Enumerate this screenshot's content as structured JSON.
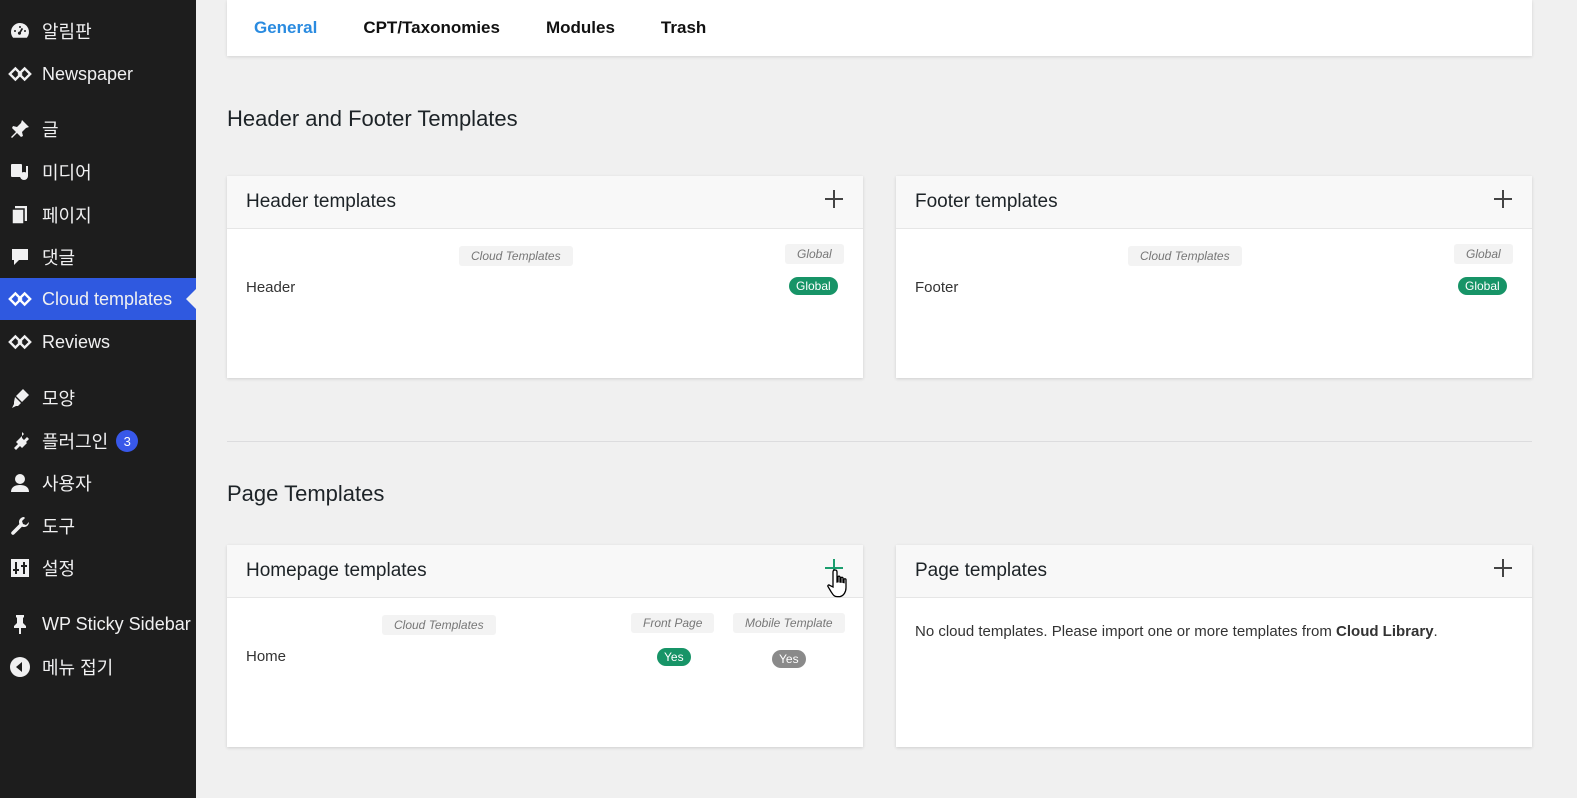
{
  "sidebar": {
    "items": [
      {
        "label": "알림판",
        "icon": "dashboard-icon"
      },
      {
        "label": "Newspaper",
        "icon": "newspaper-logo-icon"
      },
      {
        "label": "글",
        "icon": "pin-icon"
      },
      {
        "label": "미디어",
        "icon": "media-icon"
      },
      {
        "label": "페이지",
        "icon": "pages-icon"
      },
      {
        "label": "댓글",
        "icon": "comment-icon"
      },
      {
        "label": "Cloud templates",
        "icon": "newspaper-logo-icon"
      },
      {
        "label": "Reviews",
        "icon": "newspaper-logo-icon"
      },
      {
        "label": "모양",
        "icon": "brush-icon"
      },
      {
        "label": "플러그인",
        "icon": "plugin-icon",
        "badge": "3"
      },
      {
        "label": "사용자",
        "icon": "user-icon"
      },
      {
        "label": "도구",
        "icon": "wrench-icon"
      },
      {
        "label": "설정",
        "icon": "settings-icon"
      },
      {
        "label": "WP Sticky Sidebar",
        "icon": "pushpin-icon"
      },
      {
        "label": "메뉴 접기",
        "icon": "collapse-icon"
      }
    ],
    "active_index": 6,
    "active_color": "#2f59e0"
  },
  "tabs": [
    {
      "label": "General"
    },
    {
      "label": "CPT/Taxonomies"
    },
    {
      "label": "Modules"
    },
    {
      "label": "Trash"
    }
  ],
  "sections": {
    "header_footer": "Header and Footer Templates",
    "page": "Page Templates"
  },
  "cards": {
    "header": {
      "title": "Header templates",
      "col_cloud": "Cloud Templates",
      "col_global": "Global",
      "row_name": "Header",
      "row_badge": "Global"
    },
    "footer": {
      "title": "Footer templates",
      "col_cloud": "Cloud Templates",
      "col_global": "Global",
      "row_name": "Footer",
      "row_badge": "Global"
    },
    "homepage": {
      "title": "Homepage templates",
      "col_cloud": "Cloud Templates",
      "col_front": "Front Page",
      "col_mobile": "Mobile Template",
      "row_name": "Home",
      "row_front": "Yes",
      "row_mobile": "Yes"
    },
    "page": {
      "title": "Page templates",
      "empty_text": "No cloud templates. Please import one or more templates from ",
      "empty_link": "Cloud Library",
      "empty_end": "."
    }
  },
  "colors": {
    "tab_active": "#2a8be0",
    "badge_green": "#179467",
    "badge_grey": "#8a8a8a"
  }
}
